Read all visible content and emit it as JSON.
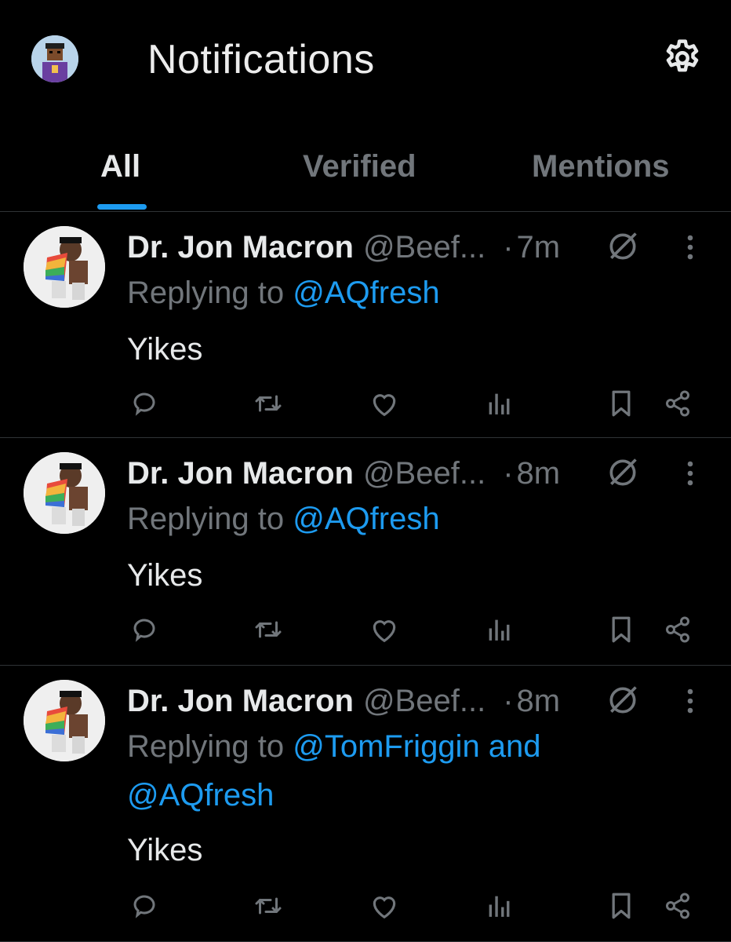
{
  "header": {
    "title": "Notifications"
  },
  "tabs": [
    {
      "label": "All",
      "active": true
    },
    {
      "label": "Verified",
      "active": false
    },
    {
      "label": "Mentions",
      "active": false
    }
  ],
  "colors": {
    "background": "#000000",
    "accent": "#1d9bf0",
    "secondary_text": "#71767b",
    "primary_text": "#e7e9ea"
  },
  "notifications": [
    {
      "name": "Dr. Jon Macron",
      "handle": "@Beef...",
      "separator": "·",
      "time": "7m",
      "replying_prefix": "Replying to",
      "reply_line1": "@AQfresh",
      "reply_line2": "",
      "text": "Yikes"
    },
    {
      "name": "Dr. Jon Macron",
      "handle": "@Beef...",
      "separator": "·",
      "time": "8m",
      "replying_prefix": "Replying to",
      "reply_line1": "@AQfresh",
      "reply_line2": "",
      "text": "Yikes"
    },
    {
      "name": "Dr. Jon Macron",
      "handle": "@Beef...",
      "separator": "·",
      "time": "8m",
      "replying_prefix": "Replying to",
      "reply_line1": "@TomFriggin and",
      "reply_line2": "@AQfresh",
      "text": "Yikes"
    }
  ],
  "icons": {
    "settings": "gear-icon",
    "mute": "muted-circle-icon",
    "more": "more-vertical-icon",
    "reply": "comment-icon",
    "retweet": "retweet-icon",
    "like": "heart-icon",
    "views": "views-chart-icon",
    "bookmark": "bookmark-icon",
    "share": "share-icon"
  }
}
